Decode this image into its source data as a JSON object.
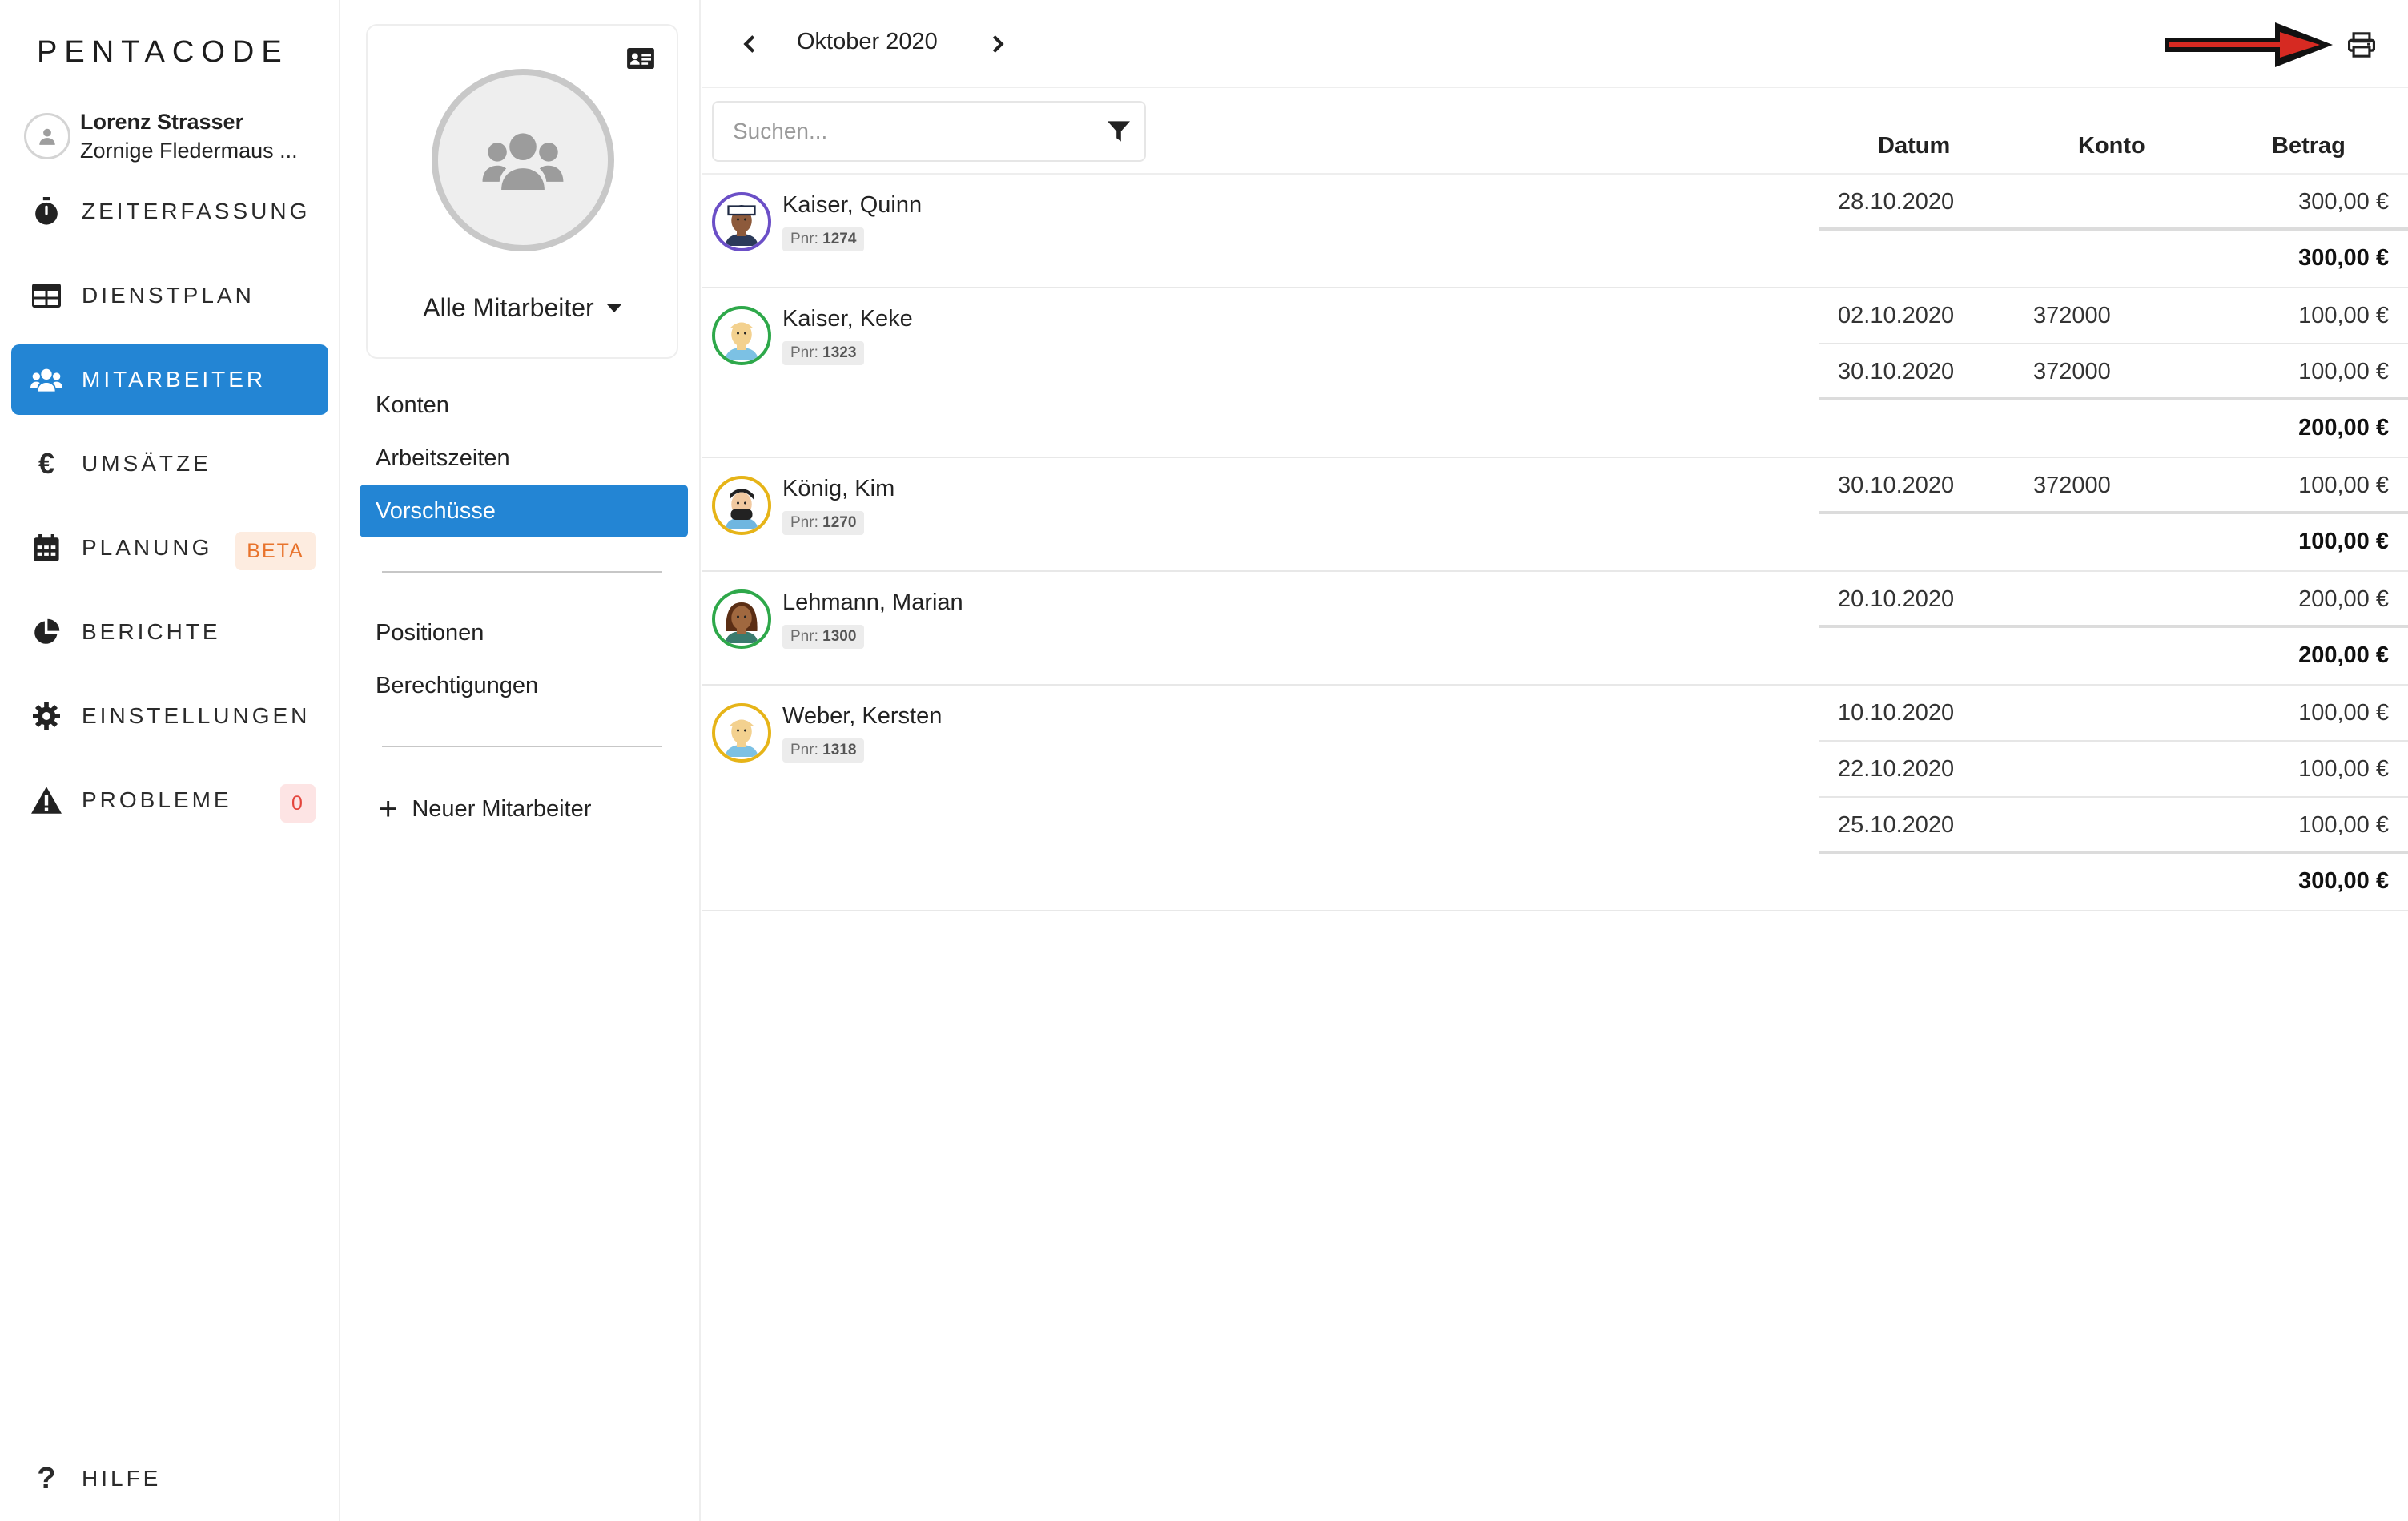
{
  "app": {
    "logo": "PENTACODE",
    "user": {
      "name": "Lorenz Strasser",
      "subtitle": "Zornige Fledermaus ..."
    }
  },
  "nav": {
    "items": [
      {
        "label": "ZEITERFASSUNG",
        "icon": "stopwatch-icon"
      },
      {
        "label": "DIENSTPLAN",
        "icon": "table-icon"
      },
      {
        "label": "MITARBEITER",
        "icon": "users-icon",
        "active": true
      },
      {
        "label": "UMSÄTZE",
        "icon": "euro-icon"
      },
      {
        "label": "PLANUNG",
        "icon": "calendar-icon",
        "badge": "BETA"
      },
      {
        "label": "BERICHTE",
        "icon": "pie-chart-icon"
      },
      {
        "label": "EINSTELLUNGEN",
        "icon": "gear-icon"
      },
      {
        "label": "PROBLEME",
        "icon": "warning-icon",
        "badge": "0"
      }
    ],
    "help": "HILFE",
    "colors": {
      "active": "#2385d4",
      "beta_bg": "#fdece0",
      "beta_text": "#e8732c",
      "problem_bg": "#fde4e4",
      "problem_text": "#e4453c"
    }
  },
  "employee_panel": {
    "group_label": "Alle Mitarbeiter",
    "menu_top": [
      "Konten",
      "Arbeitszeiten",
      "Vorschüsse"
    ],
    "active_item": "Vorschüsse",
    "menu_bottom": [
      "Positionen",
      "Berechtigungen"
    ],
    "new_employee": "Neuer Mitarbeiter"
  },
  "toolbar": {
    "month": "Oktober 2020"
  },
  "search": {
    "placeholder": "Suchen..."
  },
  "table": {
    "columns": [
      "Datum",
      "Konto",
      "Betrag"
    ],
    "pnr_label": "Pnr:",
    "groups": [
      {
        "name": "Kaiser, Quinn",
        "pnr": "1274",
        "ring": "#6b4fc7",
        "rows": [
          {
            "date": "28.10.2020",
            "account": "",
            "amount": "300,00 €"
          }
        ],
        "total": "300,00 €"
      },
      {
        "name": "Kaiser, Keke",
        "pnr": "1323",
        "ring": "#2ea84a",
        "rows": [
          {
            "date": "02.10.2020",
            "account": "372000",
            "amount": "100,00 €"
          },
          {
            "date": "30.10.2020",
            "account": "372000",
            "amount": "100,00 €"
          }
        ],
        "total": "200,00 €"
      },
      {
        "name": "König, Kim",
        "pnr": "1270",
        "ring": "#e6b418",
        "rows": [
          {
            "date": "30.10.2020",
            "account": "372000",
            "amount": "100,00 €"
          }
        ],
        "total": "100,00 €"
      },
      {
        "name": "Lehmann, Marian",
        "pnr": "1300",
        "ring": "#2ea84a",
        "rows": [
          {
            "date": "20.10.2020",
            "account": "",
            "amount": "200,00 €"
          }
        ],
        "total": "200,00 €"
      },
      {
        "name": "Weber, Kersten",
        "pnr": "1318",
        "ring": "#e6b418",
        "rows": [
          {
            "date": "10.10.2020",
            "account": "",
            "amount": "100,00 €"
          },
          {
            "date": "22.10.2020",
            "account": "",
            "amount": "100,00 €"
          },
          {
            "date": "25.10.2020",
            "account": "",
            "amount": "100,00 €"
          }
        ],
        "total": "300,00 €"
      }
    ]
  }
}
